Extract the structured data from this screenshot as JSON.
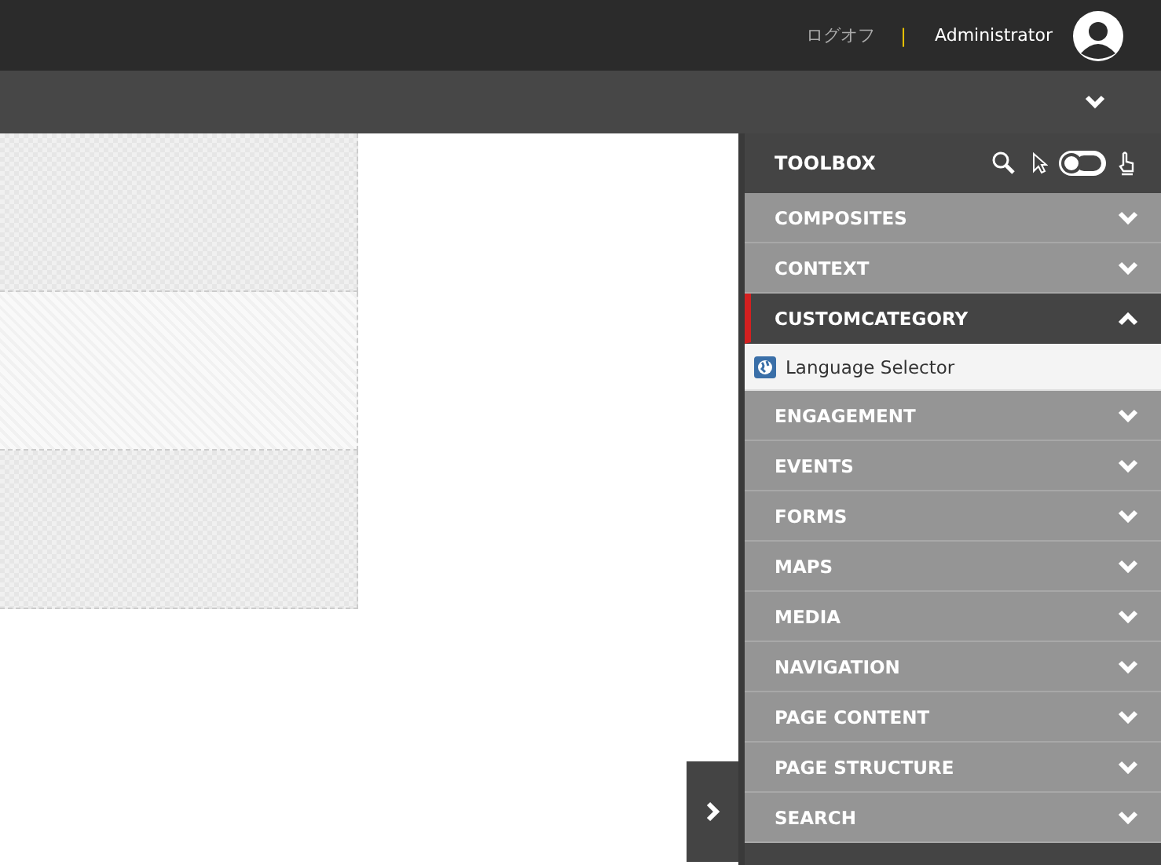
{
  "header": {
    "logoff": "ログオフ",
    "separator": "|",
    "user": "Administrator"
  },
  "placeholders": [
    {
      "kind": "checker"
    },
    {
      "kind": "diagonal"
    },
    {
      "kind": "checker"
    }
  ],
  "toolbox": {
    "title": "TOOLBOX",
    "toggle": {
      "on": false
    },
    "categories": [
      {
        "label": "COMPOSITES",
        "expanded": false
      },
      {
        "label": "CONTEXT",
        "expanded": false
      },
      {
        "label": "CUSTOMCATEGORY",
        "expanded": true,
        "items": [
          "Language Selector"
        ]
      },
      {
        "label": "ENGAGEMENT",
        "expanded": false
      },
      {
        "label": "EVENTS",
        "expanded": false
      },
      {
        "label": "FORMS",
        "expanded": false
      },
      {
        "label": "MAPS",
        "expanded": false
      },
      {
        "label": "MEDIA",
        "expanded": false
      },
      {
        "label": "NAVIGATION",
        "expanded": false
      },
      {
        "label": "PAGE CONTENT",
        "expanded": false
      },
      {
        "label": "PAGE STRUCTURE",
        "expanded": false
      },
      {
        "label": "SEARCH",
        "expanded": false
      }
    ]
  }
}
